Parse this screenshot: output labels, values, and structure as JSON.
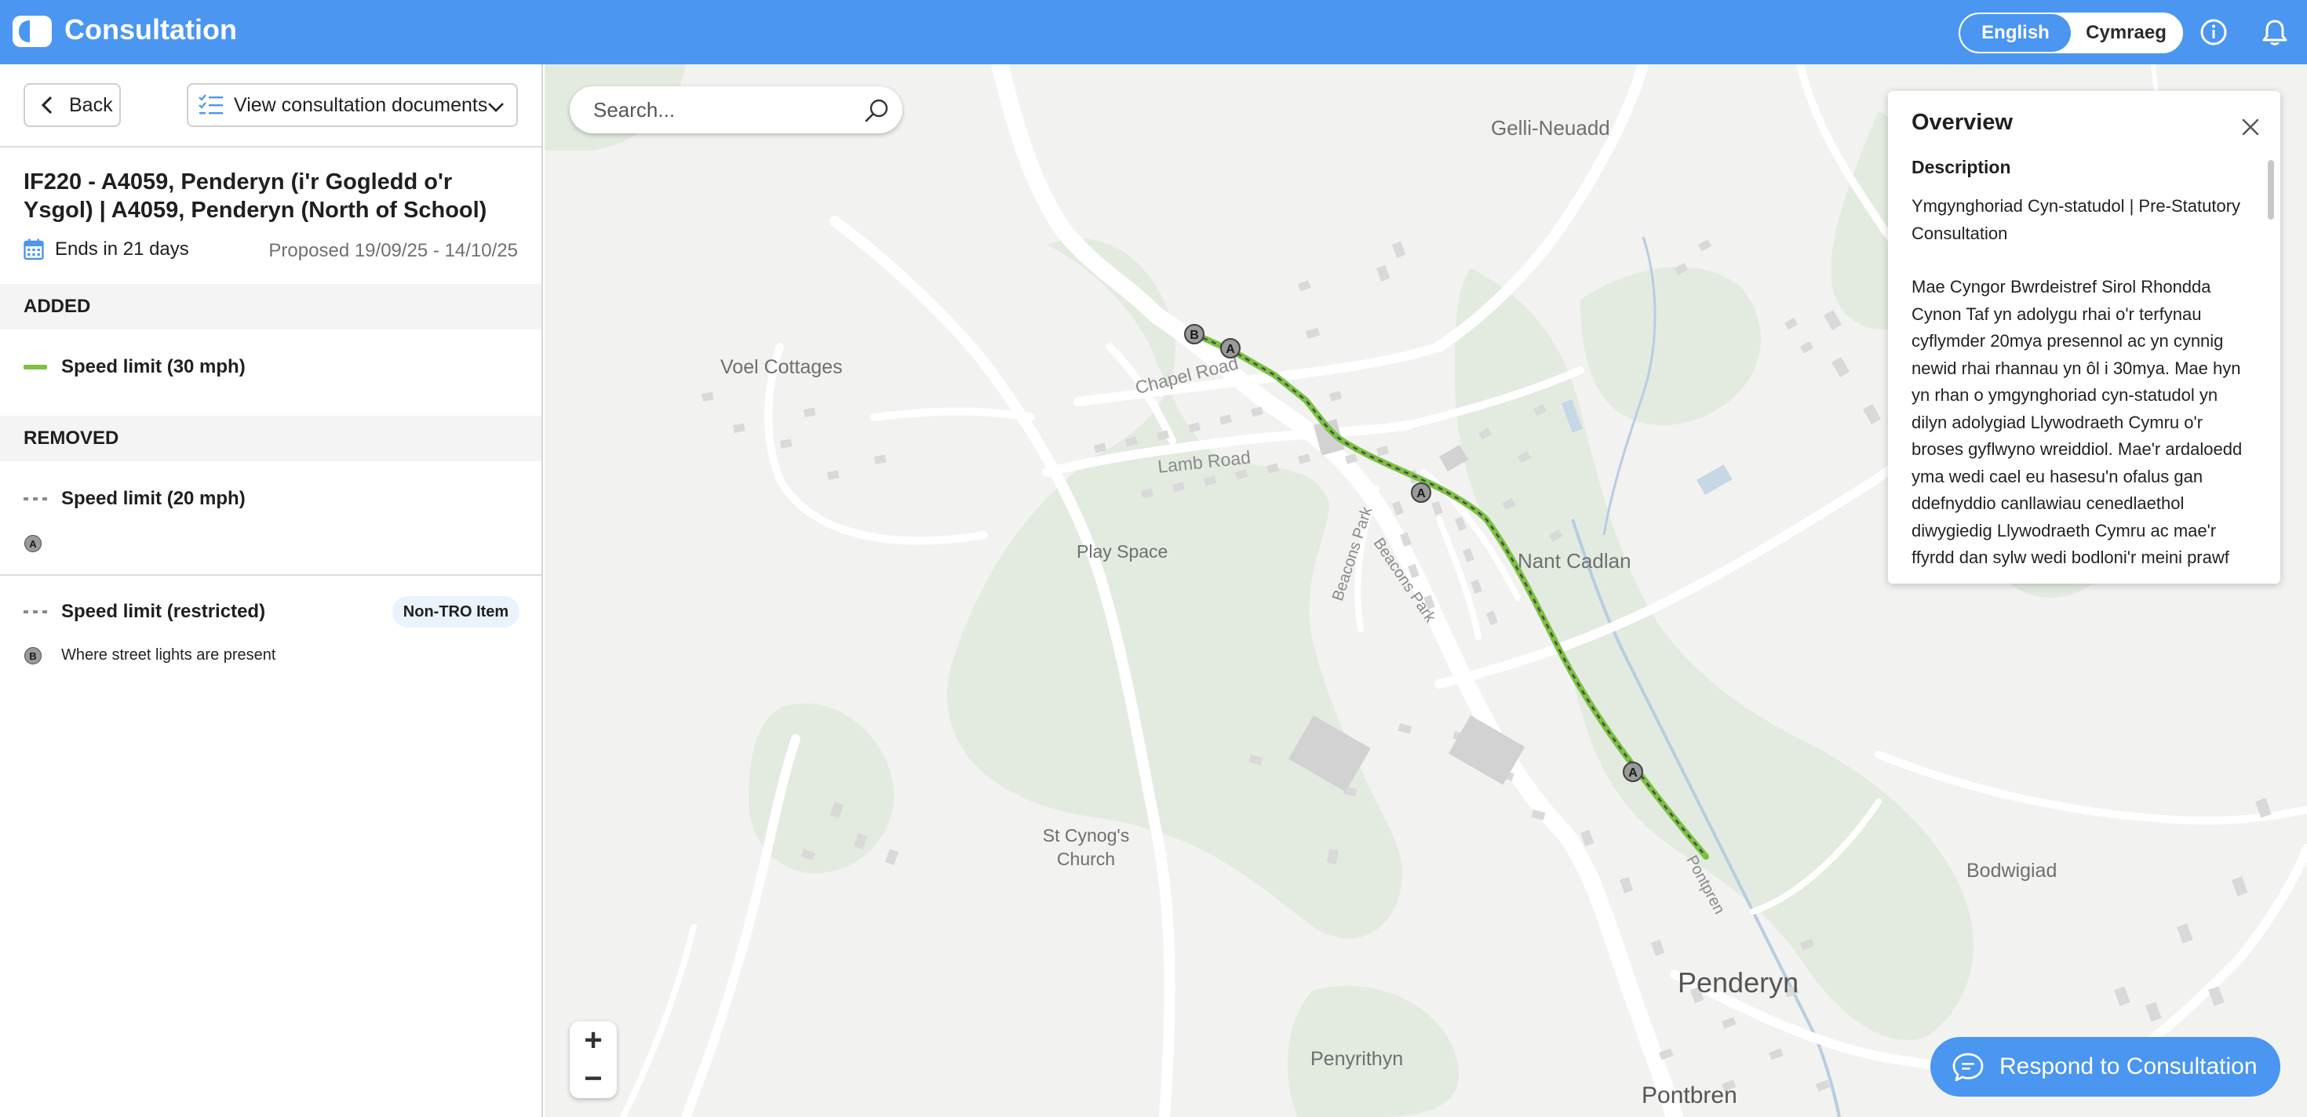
{
  "header": {
    "app_title": "Consultation",
    "lang_english": "English",
    "lang_welsh": "Cymraeg",
    "brand_color": "#4a96f0"
  },
  "sidebar": {
    "back_label": "Back",
    "docs_label": "View consultation documents",
    "title": "IF220 - A4059, Penderyn (i'r Gogledd o'r Ysgol) | A4059, Penderyn (North of School)",
    "ends_label": "Ends in 21 days",
    "proposed_label": "Proposed 19/09/25 - 14/10/25",
    "added_header": "ADDED",
    "added_item": "Speed limit (30 mph)",
    "removed_header": "REMOVED",
    "removed_item_1": "Speed limit (20 mph)",
    "marker_a": "A",
    "removed_item_2": "Speed limit (restricted)",
    "non_tro_badge": "Non-TRO Item",
    "marker_b": "B",
    "street_lights_note": "Where street lights are present"
  },
  "map": {
    "search_placeholder": "Search...",
    "zoom_in": "+",
    "zoom_out": "−",
    "labels": {
      "gelli": "Gelli-Neuadd",
      "voel": "Voel Cottages",
      "chapel": "Chapel Road",
      "lamb": "Lamb Road",
      "play": "Play Space",
      "nant": "Nant Cadlan",
      "beacons1": "Beacons Park",
      "beacons2": "Beacons Park",
      "stcynog": "St Cynog's Church",
      "bodwigiad": "Bodwigiad",
      "penderyn": "Penderyn",
      "pontpren": "Pontpren",
      "penyrithyn": "Penyrithyn",
      "pontbren": "Pontbren"
    },
    "route_color": "#7cc142",
    "markers": [
      "B",
      "A",
      "A",
      "A"
    ]
  },
  "overview": {
    "title": "Overview",
    "description_label": "Description",
    "paragraph_1": "Ymgynghoriad Cyn-statudol | Pre-Statutory Consultation",
    "paragraph_2": "Mae Cyngor Bwrdeistref Sirol Rhondda Cynon Taf yn adolygu rhai o'r terfynau cyflymder 20mya presennol ac yn cynnig newid rhai rhannau yn ôl i 30mya. Mae hyn yn rhan o ymgynghoriad cyn-statudol yn dilyn adolygiad Llywodraeth Cymru o'r broses gyflwyno wreiddiol. Mae'r ardaloedd yma wedi cael eu hasesu'n ofalus gan ddefnyddio canllawiau cenedlaethol diwygiedig Llywodraeth Cymru ac mae'r ffyrdd dan sylw wedi bodloni'r meini prawf"
  },
  "respond_label": "Respond to Consultation"
}
